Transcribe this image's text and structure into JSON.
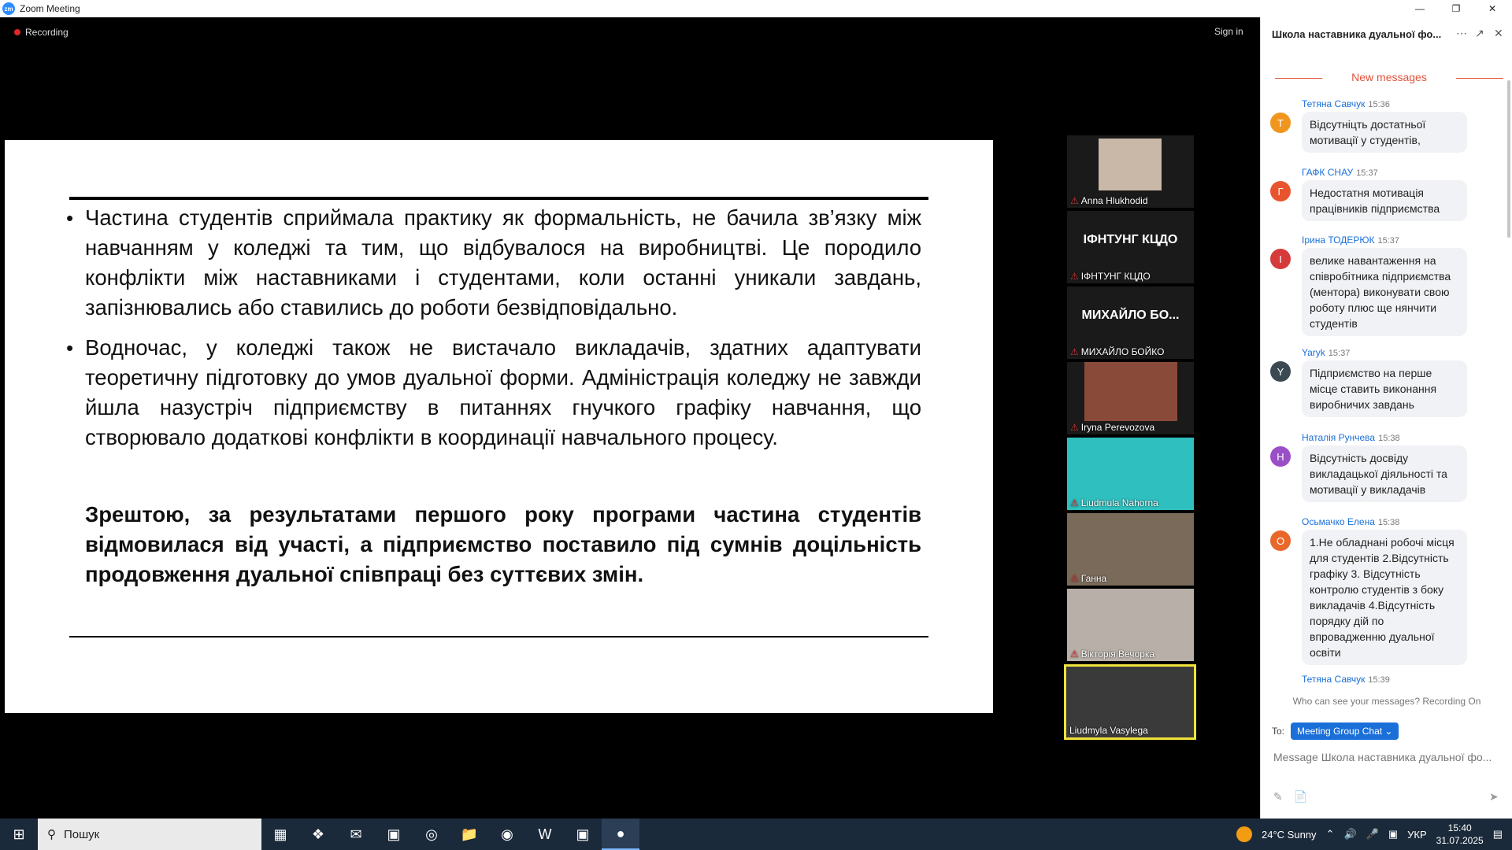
{
  "window": {
    "title": "Zoom Meeting",
    "logo": "zm"
  },
  "meeting": {
    "recording_label": "Recording",
    "signin_label": "Sign in"
  },
  "slide": {
    "para1": "Частина студентів сприймала практику як формальність, не бачила зв’язку між навчанням у коледжі та тим, що відбувалося на виробництві. Це породило конфлікти між наставниками і студентами, коли останні уникали завдань, запізнювались або ставились до роботи безвідповідально.",
    "para2": "Водночас, у коледжі також не вистачало викладачів, здатних адаптувати теоретичну підготовку до умов дуальної форми. Адміністрація коледжу не завжди йшла назустріч підприємству в питаннях гнучкого графіку навчання, що створювало додаткові конфлікти в координації навчального процесу.",
    "para3": "Зрештою, за результатами першого року програми частина студентів відмовилася від участі, а підприємство поставило під сумнів доцільність продовження дуальної співпраці без суттєвих змін.",
    "bullet": "•"
  },
  "participants": [
    {
      "name": "Anna Hlukhodid",
      "big": ""
    },
    {
      "name": "ІФНТУНГ КЦДО",
      "big": "ІФНТУНГ КЦДО"
    },
    {
      "name": "МИХАЙЛО БОЙКО",
      "big": "МИХАЙЛО БО..."
    },
    {
      "name": "Iryna Perevozova",
      "big": ""
    },
    {
      "name": "Liudmula Nahorna",
      "big": ""
    },
    {
      "name": "Ганна",
      "big": ""
    },
    {
      "name": "Вікторія Вечорка",
      "big": ""
    },
    {
      "name": "Liudmyla Vasylega",
      "big": ""
    }
  ],
  "chat": {
    "title": "Школа наставника дуальної фо...",
    "new_messages": "New messages",
    "messages": [
      {
        "author": "Тетяна Савчук",
        "time": "15:36",
        "initial": "T",
        "color": "#f0961e",
        "text": "Відсутніцть достатньої мотивації у студентів,"
      },
      {
        "author": "ГАФК СНАУ",
        "time": "15:37",
        "initial": "Г",
        "color": "#e8542e",
        "text": "Недостатня мотивація працівників підприємства"
      },
      {
        "author": "Ірина ТОДЕРЮК",
        "time": "15:37",
        "initial": "І",
        "color": "#d63a3a",
        "text": "велике навантаження на співробітника підприємства (ментора) виконувати свою роботу плюс ще нянчити студентів"
      },
      {
        "author": "Yaryk",
        "time": "15:37",
        "initial": "Y",
        "color": "#3b4a52",
        "text": "Підприємство на перше місце ставить виконання виробничих завдань"
      },
      {
        "author": "Наталія Рунчева",
        "time": "15:38",
        "initial": "Н",
        "color": "#9b4fc7",
        "text": "Відсутність досвіду викладацької діяльності та мотивації у викладачів"
      },
      {
        "author": "Осьмачко Елена",
        "time": "15:38",
        "initial": "О",
        "color": "#e8672a",
        "text": "1.Не обладнані робочі місця для студентів 2.Відсутність графіку 3. Відсутність контролю студентів з боку викладачів 4.Відсутність порядку дій по впровадженню дуальної освіти"
      },
      {
        "author": "Тетяна Савчук",
        "time": "15:39",
        "initial": "T",
        "color": "#f0961e",
        "text": ""
      }
    ],
    "visibility_note": "Who can see your messages? Recording On",
    "to_label": "To:",
    "recipient": "Meeting Group Chat ⌄",
    "input_placeholder": "Message Школа наставника дуальної фо..."
  },
  "taskbar": {
    "search_placeholder": "Пошук",
    "weather": "24°C  Sunny",
    "language": "УКР",
    "time": "15:40",
    "date": "31.07.2025"
  }
}
